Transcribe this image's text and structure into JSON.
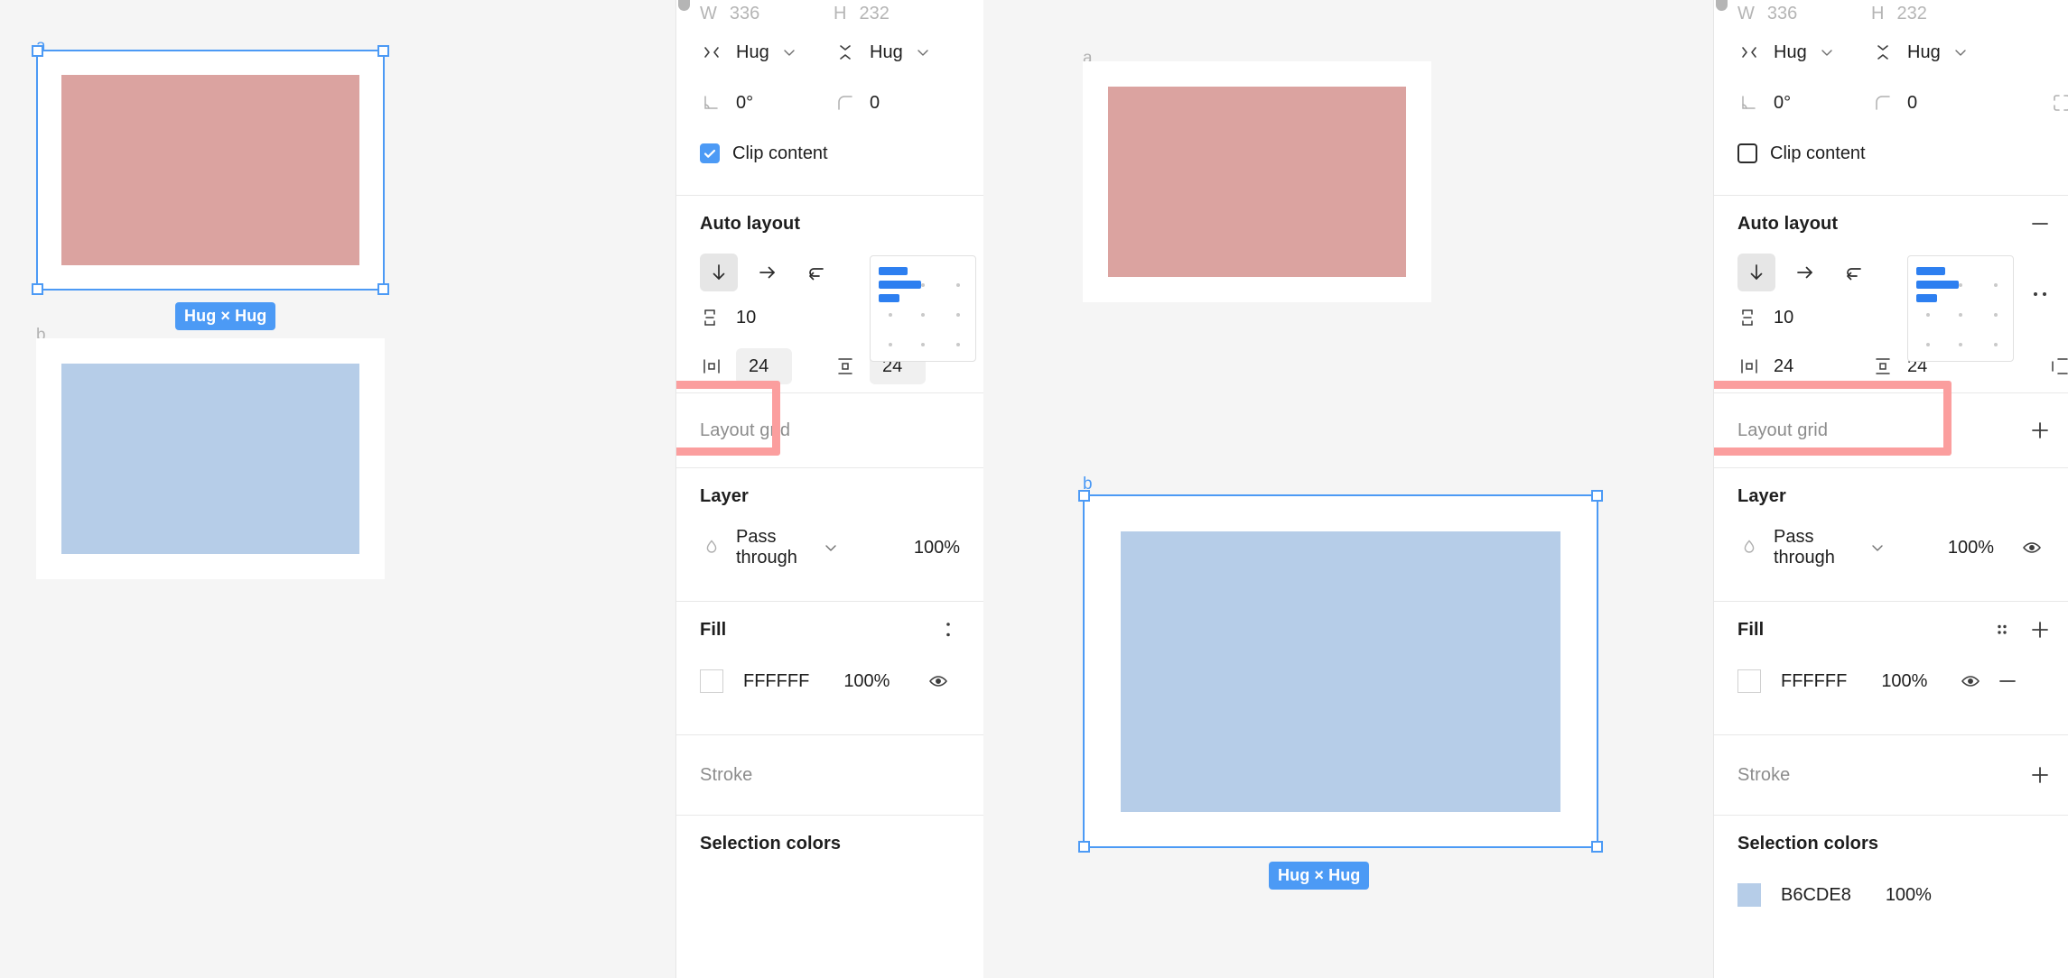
{
  "app": {
    "name": "figma-properties-panel-comparison"
  },
  "scenes": [
    {
      "id": "left",
      "frames": [
        {
          "label": "a",
          "selected": true,
          "badge": "Hug × Hug",
          "fill": "#FFFFFF",
          "child_fill": "#DBA3A0"
        },
        {
          "label": "b",
          "selected": false,
          "badge": null,
          "fill": "#FFFFFF",
          "child_fill": "#B6CDE8"
        }
      ]
    },
    {
      "id": "right",
      "frames": [
        {
          "label": "a",
          "selected": false,
          "badge": null,
          "fill": "#FFFFFF",
          "child_fill": "#DBA3A0"
        },
        {
          "label": "b",
          "selected": true,
          "badge": "Hug × Hug",
          "fill": "#FFFFFF",
          "child_fill": "#B6CDE8"
        }
      ]
    }
  ],
  "panel_left": {
    "size": {
      "w_label": "W",
      "w_value": "336",
      "h_label": "H",
      "h_value": "232"
    },
    "resizing": {
      "horizontal": "Hug",
      "vertical": "Hug"
    },
    "transform": {
      "rotation": "0°",
      "corner_radius": "0"
    },
    "clip_content": {
      "label": "Clip content",
      "checked": true
    },
    "auto_layout": {
      "title": "Auto layout",
      "direction_selected": "vertical",
      "gap": "10",
      "padding_horizontal": "24",
      "padding_vertical": "24"
    },
    "layout_grid": {
      "title": "Layout grid"
    },
    "layer": {
      "title": "Layer",
      "blend_mode": "Pass through",
      "opacity": "100%"
    },
    "fill": {
      "title": "Fill",
      "items": [
        {
          "hex": "FFFFFF",
          "opacity": "100%",
          "color": "#FFFFFF"
        }
      ]
    },
    "stroke": {
      "title": "Stroke"
    },
    "selection_colors": {
      "title": "Selection colors",
      "items": []
    }
  },
  "panel_right": {
    "size": {
      "w_label": "W",
      "w_value": "336",
      "h_label": "H",
      "h_value": "232"
    },
    "resizing": {
      "horizontal": "Hug",
      "vertical": "Hug"
    },
    "transform": {
      "rotation": "0°",
      "corner_radius": "0"
    },
    "clip_content": {
      "label": "Clip content",
      "checked": false
    },
    "auto_layout": {
      "title": "Auto layout",
      "direction_selected": "vertical",
      "gap": "10",
      "padding_horizontal": "24",
      "padding_vertical": "24"
    },
    "layout_grid": {
      "title": "Layout grid"
    },
    "layer": {
      "title": "Layer",
      "blend_mode": "Pass through",
      "opacity": "100%"
    },
    "fill": {
      "title": "Fill",
      "items": [
        {
          "hex": "FFFFFF",
          "opacity": "100%",
          "color": "#FFFFFF"
        }
      ]
    },
    "stroke": {
      "title": "Stroke"
    },
    "selection_colors": {
      "title": "Selection colors",
      "items": [
        {
          "hex": "B6CDE8",
          "opacity": "100%",
          "color": "#B6CDE8"
        }
      ]
    }
  },
  "colors": {
    "accent_blue": "#4C9AF5",
    "highlight_red": "#FB9E9E",
    "pink_rect": "#DBA3A0",
    "blue_rect": "#B6CDE8",
    "canvas_bg": "#F5F5F5"
  }
}
